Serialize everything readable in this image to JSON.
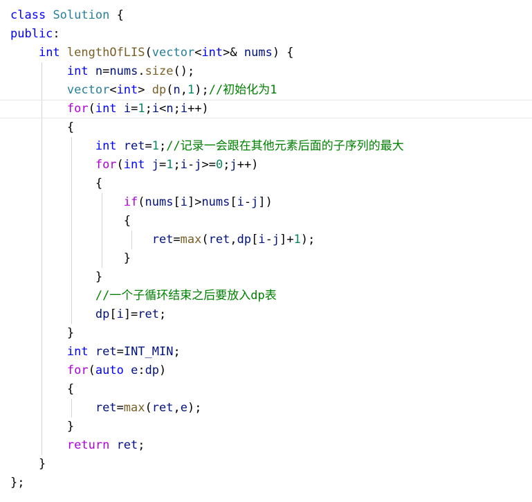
{
  "editor": {
    "language": "cpp",
    "colors": {
      "background": "#ffffff",
      "keyword": "#0000ff",
      "type": "#267f99",
      "function": "#795e26",
      "number": "#098658",
      "comment": "#008000",
      "control": "#af00db",
      "identifier": "#001080",
      "text": "#000000"
    },
    "current_line_index": 5,
    "lines": [
      [
        [
          "kw",
          "class"
        ],
        [
          "txt",
          " "
        ],
        [
          "ty",
          "Solution"
        ],
        [
          "txt",
          " {"
        ]
      ],
      [
        [
          "kw",
          "public"
        ],
        [
          "txt",
          ":"
        ]
      ],
      [
        [
          "txt",
          "    "
        ],
        [
          "kw",
          "int"
        ],
        [
          "txt",
          " "
        ],
        [
          "fn",
          "lengthOfLIS"
        ],
        [
          "txt",
          "("
        ],
        [
          "ty",
          "vector"
        ],
        [
          "txt",
          "<"
        ],
        [
          "kw",
          "int"
        ],
        [
          "txt",
          ">& "
        ],
        [
          "id",
          "nums"
        ],
        [
          "txt",
          ") {"
        ]
      ],
      [
        [
          "txt",
          "        "
        ],
        [
          "kw",
          "int"
        ],
        [
          "txt",
          " "
        ],
        [
          "id",
          "n"
        ],
        [
          "txt",
          "="
        ],
        [
          "id",
          "nums"
        ],
        [
          "txt",
          "."
        ],
        [
          "fn",
          "size"
        ],
        [
          "txt",
          "();"
        ]
      ],
      [
        [
          "txt",
          "        "
        ],
        [
          "ty",
          "vector"
        ],
        [
          "txt",
          "<"
        ],
        [
          "kw",
          "int"
        ],
        [
          "txt",
          "> "
        ],
        [
          "fn",
          "dp"
        ],
        [
          "txt",
          "("
        ],
        [
          "id",
          "n"
        ],
        [
          "txt",
          ","
        ],
        [
          "num",
          "1"
        ],
        [
          "txt",
          ");"
        ],
        [
          "cm",
          "//初始化为1"
        ]
      ],
      [
        [
          "txt",
          "        "
        ],
        [
          "ctl",
          "for"
        ],
        [
          "txt",
          "("
        ],
        [
          "kw",
          "int"
        ],
        [
          "txt",
          " "
        ],
        [
          "id",
          "i"
        ],
        [
          "txt",
          "="
        ],
        [
          "num",
          "1"
        ],
        [
          "txt",
          ";"
        ],
        [
          "id",
          "i"
        ],
        [
          "txt",
          "<"
        ],
        [
          "id",
          "n"
        ],
        [
          "txt",
          ";"
        ],
        [
          "id",
          "i"
        ],
        [
          "txt",
          "++)"
        ]
      ],
      [
        [
          "txt",
          "        {"
        ]
      ],
      [
        [
          "txt",
          "            "
        ],
        [
          "kw",
          "int"
        ],
        [
          "txt",
          " "
        ],
        [
          "id",
          "ret"
        ],
        [
          "txt",
          "="
        ],
        [
          "num",
          "1"
        ],
        [
          "txt",
          ";"
        ],
        [
          "cm",
          "//记录一会跟在其他元素后面的子序列的最大"
        ]
      ],
      [
        [
          "txt",
          "            "
        ],
        [
          "ctl",
          "for"
        ],
        [
          "txt",
          "("
        ],
        [
          "kw",
          "int"
        ],
        [
          "txt",
          " "
        ],
        [
          "id",
          "j"
        ],
        [
          "txt",
          "="
        ],
        [
          "num",
          "1"
        ],
        [
          "txt",
          ";"
        ],
        [
          "id",
          "i"
        ],
        [
          "txt",
          "-"
        ],
        [
          "id",
          "j"
        ],
        [
          "txt",
          ">="
        ],
        [
          "num",
          "0"
        ],
        [
          "txt",
          ";"
        ],
        [
          "id",
          "j"
        ],
        [
          "txt",
          "++)"
        ]
      ],
      [
        [
          "txt",
          "            {"
        ]
      ],
      [
        [
          "txt",
          "                "
        ],
        [
          "ctl",
          "if"
        ],
        [
          "txt",
          "("
        ],
        [
          "id",
          "nums"
        ],
        [
          "txt",
          "["
        ],
        [
          "id",
          "i"
        ],
        [
          "txt",
          "]>"
        ],
        [
          "id",
          "nums"
        ],
        [
          "txt",
          "["
        ],
        [
          "id",
          "i"
        ],
        [
          "txt",
          "-"
        ],
        [
          "id",
          "j"
        ],
        [
          "txt",
          "])"
        ]
      ],
      [
        [
          "txt",
          "                {"
        ]
      ],
      [
        [
          "txt",
          "                    "
        ],
        [
          "id",
          "ret"
        ],
        [
          "txt",
          "="
        ],
        [
          "fn",
          "max"
        ],
        [
          "txt",
          "("
        ],
        [
          "id",
          "ret"
        ],
        [
          "txt",
          ","
        ],
        [
          "id",
          "dp"
        ],
        [
          "txt",
          "["
        ],
        [
          "id",
          "i"
        ],
        [
          "txt",
          "-"
        ],
        [
          "id",
          "j"
        ],
        [
          "txt",
          "]+"
        ],
        [
          "num",
          "1"
        ],
        [
          "txt",
          ");"
        ]
      ],
      [
        [
          "txt",
          "                }"
        ]
      ],
      [
        [
          "txt",
          "            }"
        ]
      ],
      [
        [
          "txt",
          "            "
        ],
        [
          "cm",
          "//一个子循环结束之后要放入dp表"
        ]
      ],
      [
        [
          "txt",
          "            "
        ],
        [
          "id",
          "dp"
        ],
        [
          "txt",
          "["
        ],
        [
          "id",
          "i"
        ],
        [
          "txt",
          "]="
        ],
        [
          "id",
          "ret"
        ],
        [
          "txt",
          ";"
        ]
      ],
      [
        [
          "txt",
          "        }"
        ]
      ],
      [
        [
          "txt",
          "        "
        ],
        [
          "kw",
          "int"
        ],
        [
          "txt",
          " "
        ],
        [
          "id",
          "ret"
        ],
        [
          "txt",
          "="
        ],
        [
          "id",
          "INT_MIN"
        ],
        [
          "txt",
          ";"
        ]
      ],
      [
        [
          "txt",
          "        "
        ],
        [
          "ctl",
          "for"
        ],
        [
          "txt",
          "("
        ],
        [
          "kw",
          "auto"
        ],
        [
          "txt",
          " "
        ],
        [
          "id",
          "e"
        ],
        [
          "txt",
          ":"
        ],
        [
          "id",
          "dp"
        ],
        [
          "txt",
          ")"
        ]
      ],
      [
        [
          "txt",
          "        {"
        ]
      ],
      [
        [
          "txt",
          "            "
        ],
        [
          "id",
          "ret"
        ],
        [
          "txt",
          "="
        ],
        [
          "fn",
          "max"
        ],
        [
          "txt",
          "("
        ],
        [
          "id",
          "ret"
        ],
        [
          "txt",
          ","
        ],
        [
          "id",
          "e"
        ],
        [
          "txt",
          ");"
        ]
      ],
      [
        [
          "txt",
          "        }"
        ]
      ],
      [
        [
          "txt",
          "        "
        ],
        [
          "ctl",
          "return"
        ],
        [
          "txt",
          " "
        ],
        [
          "id",
          "ret"
        ],
        [
          "txt",
          ";"
        ]
      ],
      [
        [
          "txt",
          "    }"
        ]
      ],
      [
        [
          "txt",
          "};"
        ]
      ]
    ]
  }
}
